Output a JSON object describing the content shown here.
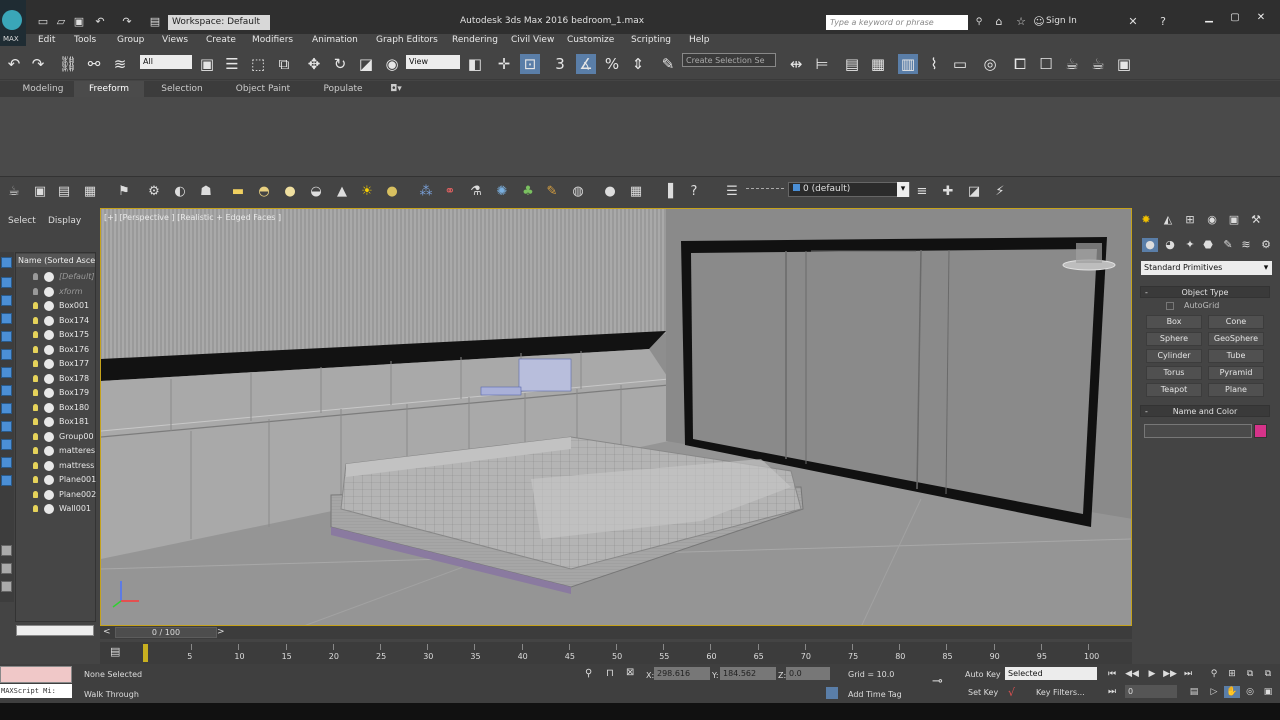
{
  "app": {
    "title": "Autodesk 3ds Max 2016     bedroom_1.max",
    "workspace": "Workspace: Default",
    "search_placeholder": "Type a keyword or phrase",
    "sign_in": "Sign In",
    "logo_text": "MAX"
  },
  "menu": [
    "Edit",
    "Tools",
    "Group",
    "Views",
    "Create",
    "Modifiers",
    "Animation",
    "Graph Editors",
    "Rendering",
    "Civil View",
    "Customize",
    "Scripting",
    "Help"
  ],
  "toolbar": {
    "filter_value": "All",
    "coord_value": "View",
    "selection_set_placeholder": "Create Selection Se"
  },
  "ribbon": {
    "tabs": [
      "Modeling",
      "Freeform",
      "Selection",
      "Object Paint",
      "Populate"
    ],
    "active_tab": "Freeform"
  },
  "layer": {
    "current": "0 (default)"
  },
  "explorer": {
    "tabs": [
      "Select",
      "Display"
    ],
    "header": "Name (Sorted Ascer",
    "items": [
      {
        "name": "[Default]",
        "dim": true
      },
      {
        "name": "xform",
        "dim": true
      },
      {
        "name": "Box001",
        "dim": false
      },
      {
        "name": "Box174",
        "dim": false
      },
      {
        "name": "Box175",
        "dim": false
      },
      {
        "name": "Box176",
        "dim": false
      },
      {
        "name": "Box177",
        "dim": false
      },
      {
        "name": "Box178",
        "dim": false
      },
      {
        "name": "Box179",
        "dim": false
      },
      {
        "name": "Box180",
        "dim": false
      },
      {
        "name": "Box181",
        "dim": false
      },
      {
        "name": "Group00",
        "dim": false
      },
      {
        "name": "matteres",
        "dim": false
      },
      {
        "name": "mattress",
        "dim": false
      },
      {
        "name": "Plane001",
        "dim": false
      },
      {
        "name": "Plane002",
        "dim": false
      },
      {
        "name": "Wall001",
        "dim": false
      }
    ]
  },
  "viewport": {
    "label": "[+] [Perspective ] [Realistic + Edged Faces ]"
  },
  "command_panel": {
    "category": "Standard Primitives",
    "object_type_title": "Object Type",
    "autogrid": "AutoGrid",
    "buttons": [
      "Box",
      "Cone",
      "Sphere",
      "GeoSphere",
      "Cylinder",
      "Tube",
      "Torus",
      "Pyramid",
      "Teapot",
      "Plane"
    ],
    "name_color_title": "Name and Color",
    "swatch_color": "#d6338a"
  },
  "timeline": {
    "position": "0 / 100",
    "ticks": [
      "5",
      "10",
      "15",
      "20",
      "25",
      "30",
      "35",
      "40",
      "45",
      "50",
      "55",
      "60",
      "65",
      "70",
      "75",
      "80",
      "85",
      "90",
      "95",
      "100"
    ]
  },
  "status": {
    "maxscript": "MAXScript Mi:",
    "selection": "None Selected",
    "prompt": "Walk Through",
    "x_label": "X:",
    "x_value": "298.616",
    "y_label": "Y:",
    "y_value": "184.562",
    "z_label": "Z:",
    "z_value": "0.0",
    "grid": "Grid = 10.0",
    "add_time_tag": "Add Time Tag",
    "auto_key": "Auto Key",
    "set_key": "Set Key",
    "key_mode": "Selected",
    "key_filters": "Key Filters...",
    "frame": "0"
  },
  "colors": {
    "accent_active": "#5a7ea8",
    "viewport_border": "#c5a21b"
  }
}
